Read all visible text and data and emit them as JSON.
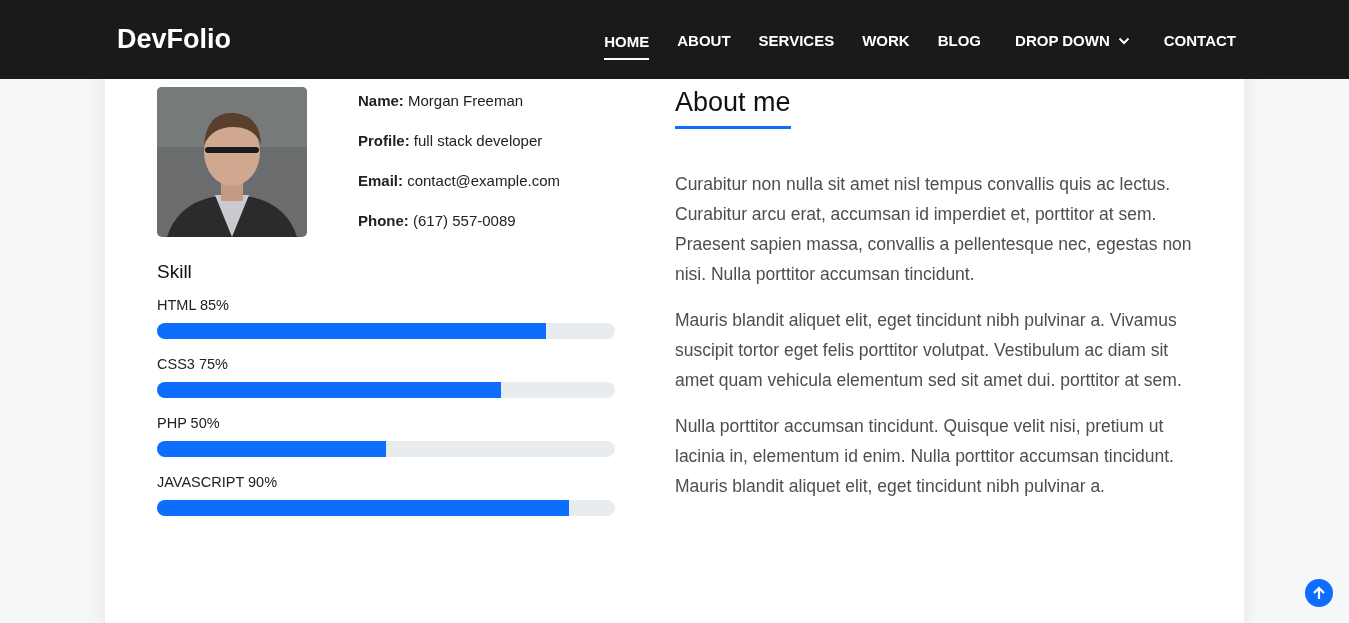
{
  "navbar": {
    "brand": "DevFolio",
    "items": [
      {
        "label": "HOME",
        "selected": true,
        "kind": "link"
      },
      {
        "label": "ABOUT",
        "selected": false,
        "kind": "link"
      },
      {
        "label": "SERVICES",
        "selected": false,
        "kind": "link"
      },
      {
        "label": "WORK",
        "selected": false,
        "kind": "link"
      },
      {
        "label": "BLOG",
        "selected": false,
        "kind": "link"
      },
      {
        "label": "DROP DOWN",
        "selected": false,
        "kind": "dropdown"
      },
      {
        "label": "CONTACT",
        "selected": false,
        "kind": "link"
      }
    ]
  },
  "profile": {
    "details": [
      "**Name:** Morgan Freeman",
      "**Profile:** full stack developer",
      "**Email:** contact@example.com",
      "**Phone:** (617) 557-0089"
    ]
  },
  "skills": {
    "title": "Skill",
    "items": [
      {
        "label": "HTML 85%",
        "level": 0.85
      },
      {
        "label": "CSS3 75%",
        "level": 0.75
      },
      {
        "label": "PHP 50%",
        "level": 0.5
      },
      {
        "label": "JAVASCRIPT 90%",
        "level": 0.9
      }
    ]
  },
  "about": {
    "title": "About me",
    "paragraphs": [
      "Curabitur non nulla sit amet nisl tempus convallis quis ac lectus. Curabitur arcu erat, accumsan id imperdiet et, porttitor at sem. Praesent sapien massa, convallis a pellentesque nec, egestas non nisi. Nulla porttitor accumsan tincidunt.",
      "Mauris blandit aliquet elit, eget tincidunt nibh pulvinar a. Vivamus suscipit tortor eget felis porttitor volutpat. Vestibulum ac diam sit amet quam vehicula elementum sed sit amet dui. porttitor at sem.",
      "Nulla porttitor accumsan tincidunt. Quisque velit nisi, pretium ut lacinia in, elementum id enim. Nulla porttitor accumsan tincidunt. Mauris blandit aliquet elit, eget tincidunt nibh pulvinar a."
    ]
  },
  "back_to_top": {
    "kind": "arrow"
  }
}
